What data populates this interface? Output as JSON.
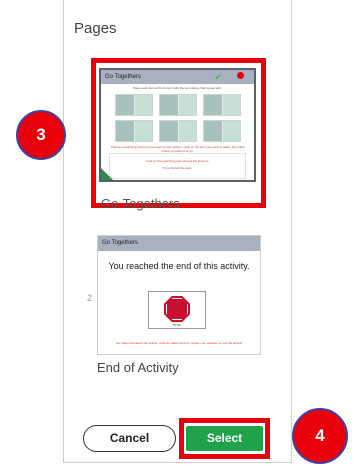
{
  "panel": {
    "title": "Pages"
  },
  "pages": [
    {
      "number": "",
      "label": "Go-Togethers",
      "thumbnail": {
        "header": "Go Togethers",
        "instruction": "Place each item at the bottom with the item above that it goes with.",
        "note1": "Choose a matching picture to put next to each picture. Click on the item you need to place, then click where you want it to go.",
        "note2": "Look for the matching pairs among the pictures.",
        "note3": "Try to find all the pairs."
      }
    },
    {
      "number": "2",
      "label": "End of Activity",
      "thumbnail": {
        "header": "Go Togethers",
        "message": "You reached the end of this activity.",
        "stop_caption": "STOP",
        "footer": "You have completed this activity. Click the Back arrow to review your answers or exit the activity."
      }
    }
  ],
  "buttons": {
    "cancel": "Cancel",
    "select": "Select"
  },
  "annotations": {
    "step3": "3",
    "step4": "4"
  },
  "colors": {
    "highlight": "#e8000b",
    "select_green": "#1fa24a",
    "badge_border": "#3b44a8"
  }
}
